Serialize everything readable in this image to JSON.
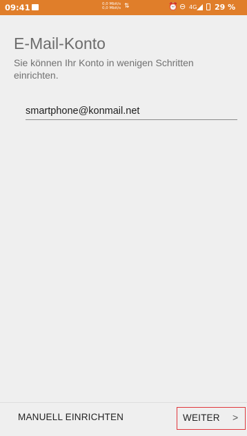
{
  "status_bar": {
    "time": "09:41",
    "speed_up": "0,0 Mbit/s",
    "speed_down": "0,0 Mbit/s",
    "network": "4G",
    "battery": "29 %",
    "background_color": "#e07e2a",
    "icons": [
      "notification-icon",
      "data-arrows-icon",
      "alarm-icon",
      "do-not-disturb-icon",
      "signal-icon",
      "battery-icon"
    ]
  },
  "header": {
    "title": "E-Mail-Konto",
    "subtitle": "Sie können Ihr Konto in wenigen Schritten einrichten."
  },
  "form": {
    "email_value": "smartphone@konmail.net"
  },
  "footer": {
    "manual_label": "MANUELL EINRICHTEN",
    "next_label": "WEITER",
    "next_icon": "chevron-right-icon",
    "highlight_color": "#e0353a"
  }
}
